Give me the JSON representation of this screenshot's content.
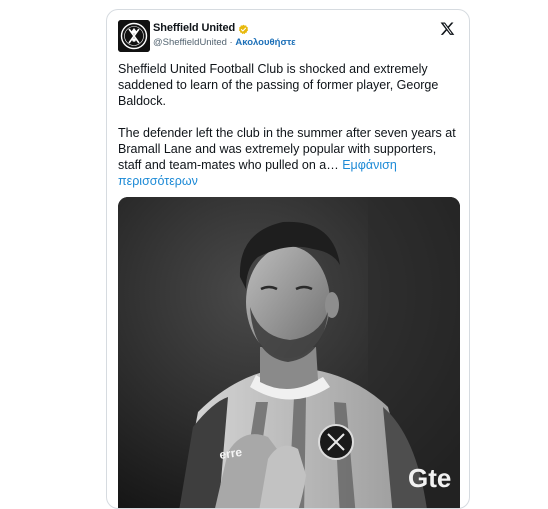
{
  "tweet": {
    "display_name": "Sheffield United",
    "handle": "@SheffieldUnited",
    "separator": "·",
    "follow_label": "Ακολουθήστε",
    "paragraph1": "Sheffield United Football Club is shocked and extremely saddened to learn of the passing of former player, George Baldock.",
    "paragraph2": "The defender left the club in the summer after seven years at Bramall Lane and was extremely popular with supporters, staff and team-mates who pulled on a…",
    "show_more_label": "Εμφάνιση περισσότερων",
    "photo_text": {
      "sponsor": "Gte",
      "kit_brand": "erre"
    }
  },
  "colors": {
    "link": "#1d8ad6",
    "follow": "#1d70b8",
    "verified": "#e8b90c",
    "text": "#0f1419",
    "muted": "#536471"
  },
  "icons": {
    "verified": "verified-badge-icon",
    "platform": "x-logo-icon",
    "avatar": "club-crest-icon"
  }
}
